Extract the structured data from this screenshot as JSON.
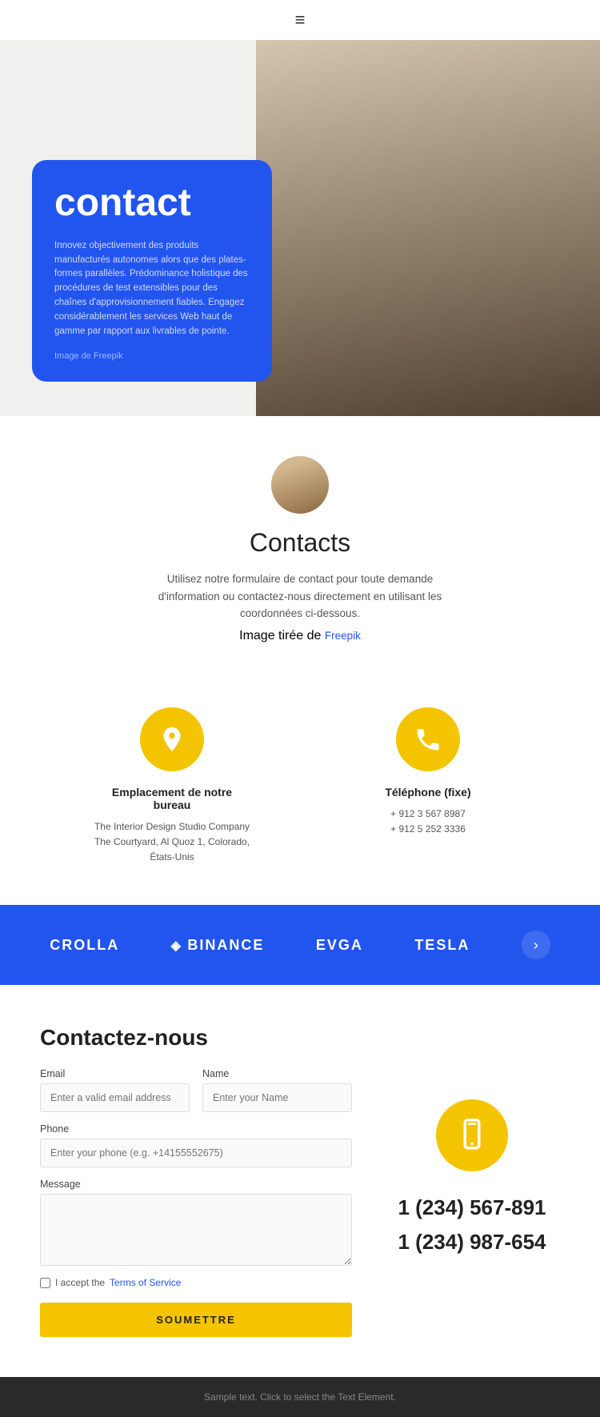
{
  "nav": {
    "hamburger_icon": "≡"
  },
  "hero": {
    "card": {
      "title": "contact",
      "description": "Innovez objectivement des produits manufacturés autonomes alors que des plates-formes parallèles. Prédominance holistique des procédures de test extensibles pour des chaînes d'approvisionnement fiables. Engagez considérablement les services Web haut de gamme par rapport aux livrables de pointe.",
      "image_credit": "Image de Freepik"
    }
  },
  "contacts_section": {
    "title": "Contacts",
    "description": "Utilisez notre formulaire de contact pour toute demande d'information ou contactez-nous directement en utilisant les coordonnées ci-dessous.",
    "image_credit_prefix": "Image tirée de ",
    "freepik_label": "Freepik"
  },
  "icon_cards": [
    {
      "id": "location",
      "title": "Emplacement de notre bureau",
      "line1": "The Interior Design Studio Company",
      "line2": "The Courtyard, Al Quoz 1, Colorado,  États-Unis"
    },
    {
      "id": "phone",
      "title": "Téléphone (fixe)",
      "line1": "+ 912 3 567 8987",
      "line2": "+ 912 5 252 3336"
    }
  ],
  "brands": {
    "items": [
      "CROLLA",
      "BINANCE",
      "EVGA",
      "TESLA"
    ],
    "arrow_label": "›"
  },
  "contact_form": {
    "section_title": "Contactez-nous",
    "email_label": "Email",
    "email_placeholder": "Enter a valid email address",
    "name_label": "Name",
    "name_placeholder": "Enter your Name",
    "phone_label": "Phone",
    "phone_placeholder": "Enter your phone (e.g. +14155552675)",
    "message_label": "Message",
    "checkbox_text": "I accept the ",
    "terms_label": "Terms of Service",
    "submit_label": "SOUMETTRE"
  },
  "phone_side": {
    "number1": "1 (234) 567-891",
    "number2": "1 (234) 987-654"
  },
  "footer": {
    "text": "Sample text. Click to select the Text Element."
  }
}
